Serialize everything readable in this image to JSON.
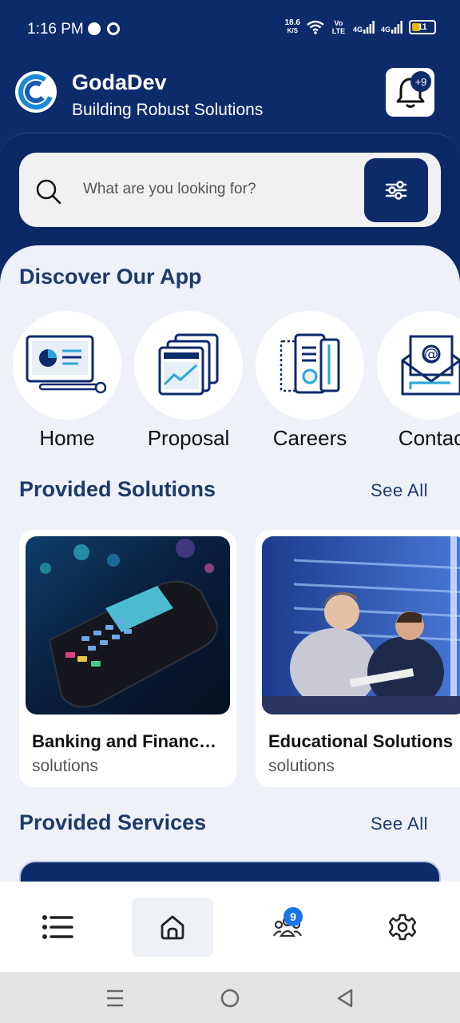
{
  "status_bar": {
    "time": "1:16 PM",
    "speed_value": "18.6",
    "speed_unit": "K/S",
    "volte": "Vo LTE",
    "net1": "4G",
    "net2": "4G",
    "battery": "11"
  },
  "header": {
    "app_name": "GodaDev",
    "tagline": "Building Robust Solutions",
    "notification_badge": "+9"
  },
  "search": {
    "placeholder": "What are you looking for?"
  },
  "discover": {
    "title": "Discover Our App",
    "apps": [
      {
        "label": "Home",
        "icon": "dashboard-icon"
      },
      {
        "label": "Proposal",
        "icon": "proposal-chart-icon"
      },
      {
        "label": "Careers",
        "icon": "careers-document-icon"
      },
      {
        "label": "Contac",
        "icon": "email-envelope-icon"
      }
    ]
  },
  "solutions": {
    "title": "Provided Solutions",
    "see_all": "See All",
    "cards": [
      {
        "title": "Banking and Financ…",
        "subtitle": "solutions"
      },
      {
        "title": "Educational Solutions",
        "subtitle": "solutions"
      }
    ]
  },
  "services": {
    "title": "Provided Services",
    "see_all": "See All"
  },
  "bottom_nav": {
    "items": [
      "menu-list-icon",
      "home-icon",
      "users-icon",
      "settings-icon"
    ],
    "users_badge": "9",
    "active": "home-icon"
  },
  "colors": {
    "primary": "#0d2a6b",
    "background": "#eef1f8",
    "badge": "#1976e8"
  }
}
